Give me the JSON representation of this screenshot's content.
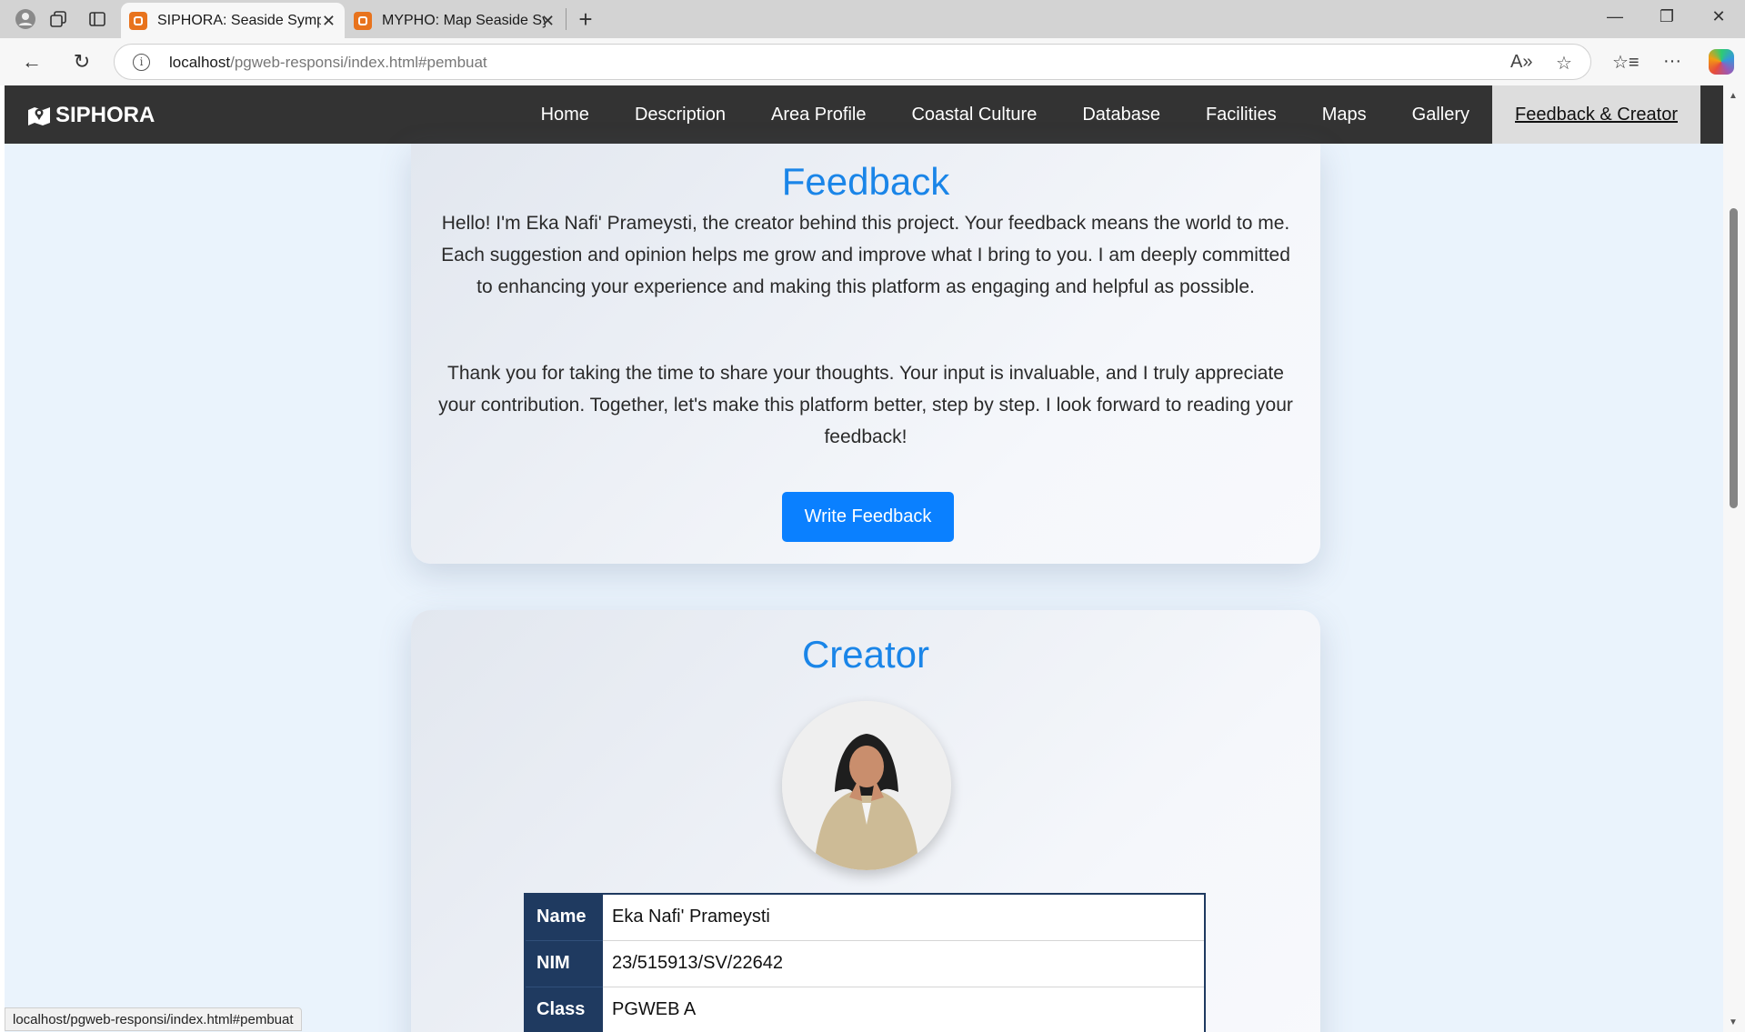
{
  "browser": {
    "tabs": [
      {
        "title": "SIPHORA: Seaside Symphony Ren",
        "active": true
      },
      {
        "title": "MYPHO: Map Seaside Symphony",
        "active": false
      }
    ],
    "url_host": "localhost",
    "url_path": "/pgweb-responsi/index.html#pembuat",
    "status_url": "localhost/pgweb-responsi/index.html#pembuat"
  },
  "site": {
    "brand": "SIPHORA",
    "nav": [
      "Home",
      "Description",
      "Area Profile",
      "Coastal Culture",
      "Database",
      "Facilities",
      "Maps",
      "Gallery",
      "Feedback & Creator"
    ],
    "active_nav": "Feedback & Creator"
  },
  "feedback": {
    "title": "Feedback",
    "paragraph1": "Hello! I'm Eka Nafi' Prameysti, the creator behind this project. Your feedback means the world to me. Each suggestion and opinion helps me grow and improve what I bring to you. I am deeply committed to enhancing your experience and making this platform as engaging and helpful as possible.",
    "paragraph2": "Thank you for taking the time to share your thoughts. Your input is invaluable, and I truly appreciate your contribution. Together, let's make this platform better, step by step. I look forward to reading your feedback!",
    "button": "Write Feedback"
  },
  "creator": {
    "title": "Creator",
    "rows": [
      {
        "label": "Name",
        "value": "Eka Nafi' Prameysti"
      },
      {
        "label": "NIM",
        "value": "23/515913/SV/22642"
      },
      {
        "label": "Class",
        "value": "PGWEB A"
      }
    ]
  },
  "colors": {
    "accent": "#1a85e8",
    "button": "#0a80ff",
    "nav_bg": "#333333",
    "table_header": "#1f3a60",
    "page_bg": "#eaf3fc"
  }
}
